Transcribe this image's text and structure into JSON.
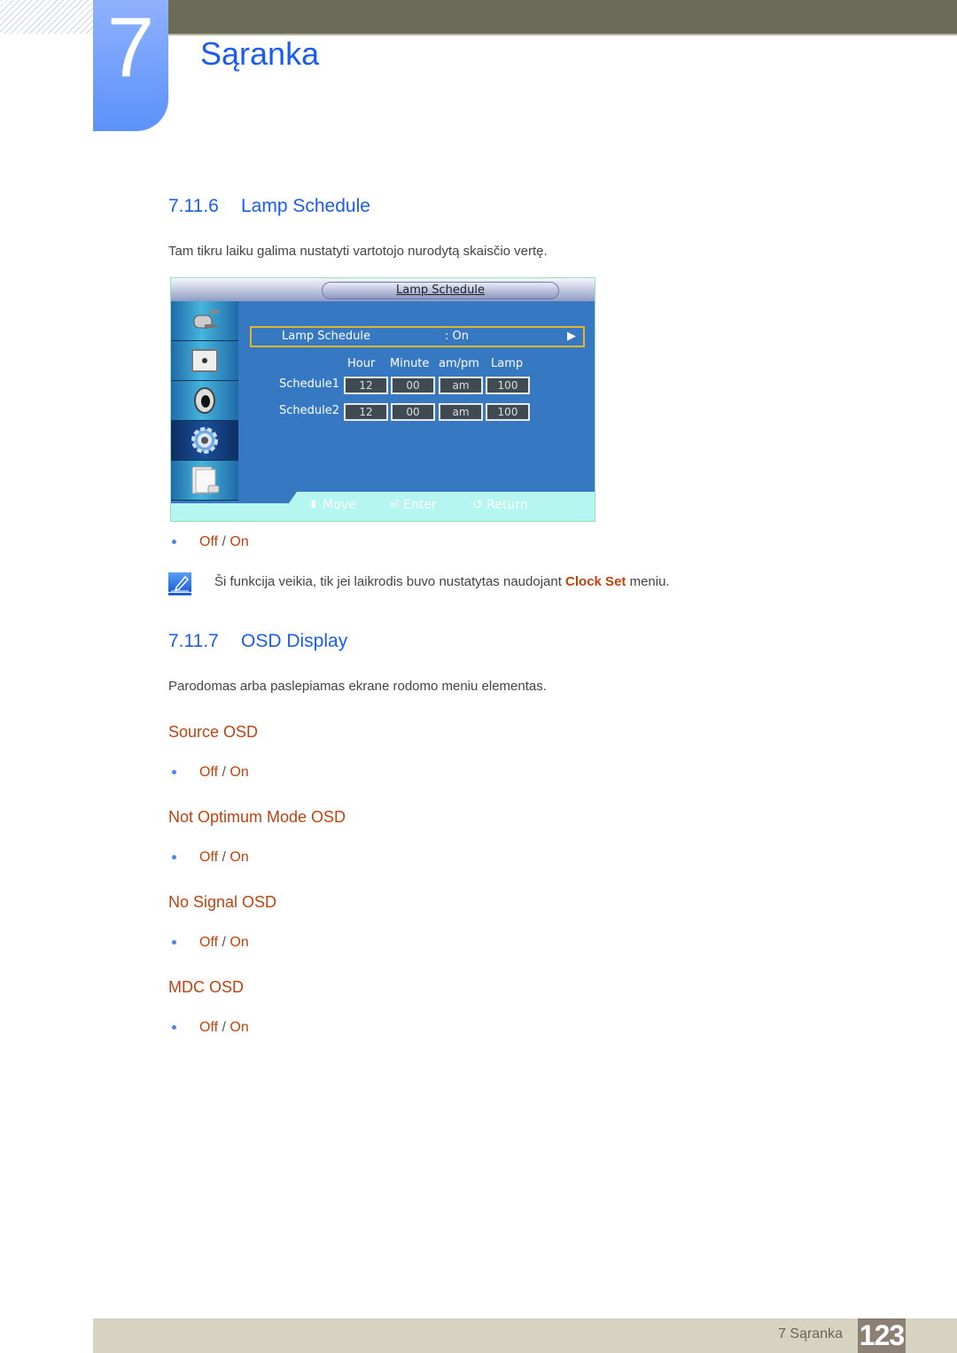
{
  "header": {
    "chapter_number": "7",
    "chapter_title": "Sąranka"
  },
  "sections": {
    "lamp_schedule": {
      "number": "7.11.6",
      "title": "Lamp Schedule",
      "description": "Tam tikru laiku galima nustatyti vartotojo nurodytą skaisčio vertę.",
      "option_off": "Off",
      "option_sep": "/",
      "option_on": "On",
      "note": {
        "icon": "note-pencil-icon",
        "text_before": "Ši funkcija veikia, tik jei laikrodis buvo nustatytas naudojant ",
        "highlight": "Clock Set",
        "text_after": " meniu."
      }
    },
    "osd_display": {
      "number": "7.11.7",
      "title": "OSD Display",
      "description": "Parodomas arba paslepiamas ekrane rodomo meniu elementas.",
      "subsections": [
        {
          "title": "Source OSD",
          "off": "Off",
          "sep": "/",
          "on": "On"
        },
        {
          "title": "Not Optimum Mode OSD",
          "off": "Off",
          "sep": "/",
          "on": "On"
        },
        {
          "title": "No Signal OSD",
          "off": "Off",
          "sep": "/",
          "on": "On"
        },
        {
          "title": "MDC OSD",
          "off": "Off",
          "sep": "/",
          "on": "On"
        }
      ]
    }
  },
  "osd_screen": {
    "title": "Lamp Schedule",
    "sidebar_icons": [
      "input-plug-icon",
      "picture-icon",
      "speaker-icon",
      "setup-gear-icon",
      "multi-control-icon"
    ],
    "active_sidebar_index": 3,
    "selected_row": {
      "label": "Lamp Schedule",
      "value": ": On",
      "arrow": "▶"
    },
    "columns": [
      "Hour",
      "Minute",
      "am/pm",
      "Lamp"
    ],
    "schedules": [
      {
        "label": "Schedule1",
        "hour": "12",
        "minute": "00",
        "ampm": "am",
        "lamp": "100"
      },
      {
        "label": "Schedule2",
        "hour": "12",
        "minute": "00",
        "ampm": "am",
        "lamp": "100"
      }
    ],
    "footer": {
      "move": "Move",
      "enter": "Enter",
      "return": "Return"
    }
  },
  "colors": {
    "heading_blue": "#1a5cf2",
    "accent_orange": "#c0430f",
    "osd_blue": "#3679c2",
    "footer_bg": "#d8d3c0",
    "page_box": "#8c8074"
  },
  "footer": {
    "label": "7 Sąranka",
    "page_number": "123"
  }
}
